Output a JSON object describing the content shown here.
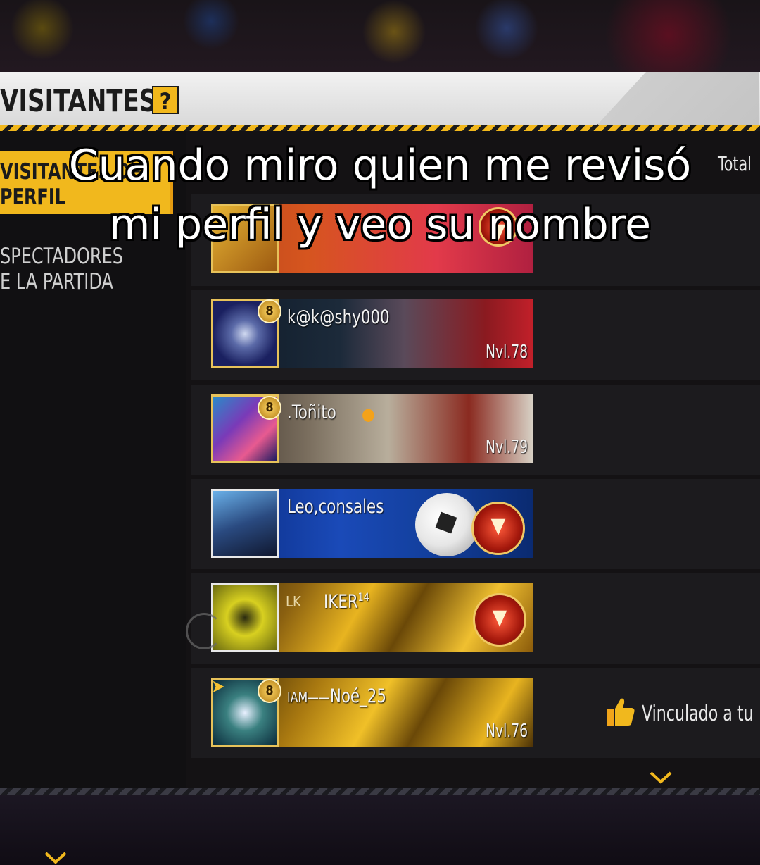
{
  "header": {
    "title": "VISITANTES",
    "help": "?"
  },
  "sidebar": {
    "tabs": [
      {
        "line1": "VISITANTES DE",
        "line2": "PERFIL",
        "active": true
      },
      {
        "line1": "SPECTADORES",
        "line2": "E LA PARTIDA",
        "active": false
      }
    ]
  },
  "total_label": "Total",
  "caption": {
    "line1": "Cuando miro quien me revisó",
    "line2": "mi perfil y veo su nombre"
  },
  "visitors": [
    {
      "name": "",
      "level": "",
      "rank": ""
    },
    {
      "name": "k@k@shy000",
      "level": "Nvl.78",
      "rank": "8"
    },
    {
      "name": ".Toñito",
      "level": "Nvl.79",
      "rank": "8"
    },
    {
      "name": "Leo,consales",
      "level": "",
      "rank": ""
    },
    {
      "name": "IKER",
      "prefix": "LK",
      "superscript": "14",
      "level": "",
      "rank": ""
    },
    {
      "name": "Noé_25",
      "prefix": "IAM——",
      "level": "Nvl.76",
      "rank": "8"
    }
  ],
  "linked": {
    "label": "Vinculado a tu",
    "icon": "thumbs-up-icon"
  },
  "colors": {
    "accent": "#f1b81d",
    "panel": "#1c1b1e",
    "header": "#e6e6e6"
  }
}
